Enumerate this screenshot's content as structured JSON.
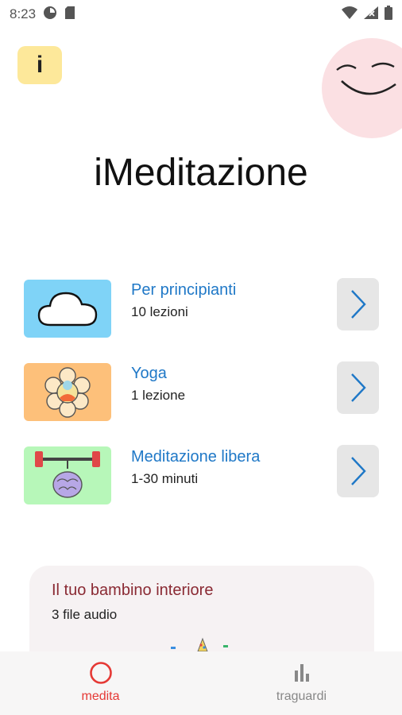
{
  "status_bar": {
    "time": "8:23"
  },
  "header": {
    "info_label": "i"
  },
  "app": {
    "title": "iMeditazione"
  },
  "sections": [
    {
      "title": "Per principianti",
      "subtitle": "10 lezioni"
    },
    {
      "title": "Yoga",
      "subtitle": "1 lezione"
    },
    {
      "title": "Meditazione libera",
      "subtitle": "1-30 minuti"
    }
  ],
  "promo": {
    "title": "Il tuo bambino interiore",
    "subtitle": "3 file audio"
  },
  "nav": {
    "tabs": [
      {
        "label": "medita",
        "active": true
      },
      {
        "label": "traguardi",
        "active": false
      }
    ]
  },
  "colors": {
    "accent_red": "#e53935",
    "link_blue": "#1f78c7",
    "thumb_sky": "#7fd3f7",
    "thumb_orange": "#fdc07a",
    "thumb_green": "#b7f7b9",
    "info_yellow": "#fde89a",
    "face_pink": "#fbe0e3"
  }
}
